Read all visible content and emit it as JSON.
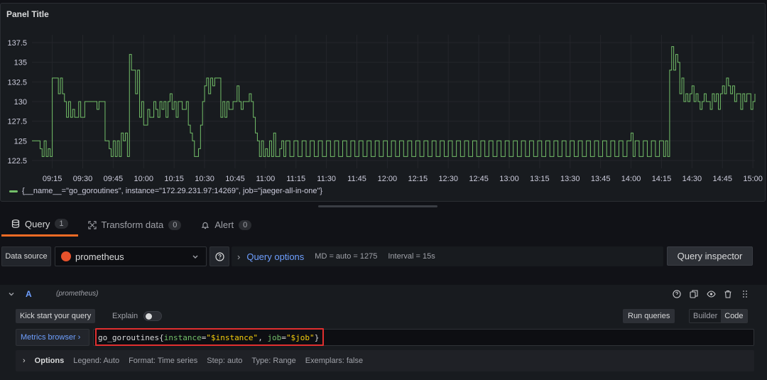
{
  "panel": {
    "title": "Panel Title",
    "legend": "{__name__=\"go_goroutines\", instance=\"172.29.231.97:14269\", job=\"jaeger-all-in-one\"}"
  },
  "chart_data": {
    "type": "line",
    "title": "Panel Title",
    "ylim": [
      121.5,
      138.5
    ],
    "yticks": [
      "122.5",
      "125",
      "127.5",
      "130",
      "132.5",
      "135",
      "137.5"
    ],
    "xticks": [
      "09:15",
      "09:30",
      "09:45",
      "10:00",
      "10:15",
      "10:30",
      "10:45",
      "11:00",
      "11:15",
      "11:30",
      "11:45",
      "12:00",
      "12:15",
      "12:30",
      "12:45",
      "13:00",
      "13:15",
      "13:30",
      "13:45",
      "14:00",
      "14:15",
      "14:30",
      "14:45",
      "15:00"
    ],
    "grid": true,
    "legend_position": "bottom",
    "series": [
      {
        "name": "{__name__=\"go_goroutines\", instance=\"172.29.231.97:14269\", job=\"jaeger-all-in-one\"}",
        "color": "#73bf69",
        "points": [
          [
            "09:05",
            125
          ],
          [
            "09:08",
            125
          ],
          [
            "09:09",
            124
          ],
          [
            "09:10",
            123
          ],
          [
            "09:11",
            125
          ],
          [
            "09:12",
            123
          ],
          [
            "09:13",
            124
          ],
          [
            "09:14",
            123
          ],
          [
            "09:15",
            133
          ],
          [
            "09:17",
            133
          ],
          [
            "09:18",
            131
          ],
          [
            "09:19",
            133
          ],
          [
            "09:20",
            131
          ],
          [
            "09:21",
            130
          ],
          [
            "09:22",
            128
          ],
          [
            "09:23",
            130
          ],
          [
            "09:24",
            128
          ],
          [
            "09:25",
            129
          ],
          [
            "09:26",
            128
          ],
          [
            "09:28",
            130
          ],
          [
            "09:29",
            128
          ],
          [
            "09:30",
            128
          ],
          [
            "09:31",
            130
          ],
          [
            "09:36",
            130
          ],
          [
            "09:37",
            129
          ],
          [
            "09:38",
            130
          ],
          [
            "09:40",
            130
          ],
          [
            "09:41",
            125
          ],
          [
            "09:43",
            124
          ],
          [
            "09:44",
            123
          ],
          [
            "09:45",
            125
          ],
          [
            "09:46",
            123
          ],
          [
            "09:47",
            125
          ],
          [
            "09:48",
            123
          ],
          [
            "09:49",
            126
          ],
          [
            "09:50",
            125
          ],
          [
            "09:51",
            126
          ],
          [
            "09:52",
            123
          ],
          [
            "09:53",
            136
          ],
          [
            "09:54",
            134
          ],
          [
            "09:55",
            134
          ],
          [
            "09:56",
            131
          ],
          [
            "09:57",
            134
          ],
          [
            "09:58",
            128
          ],
          [
            "09:59",
            130
          ],
          [
            "10:00",
            127
          ],
          [
            "10:02",
            129
          ],
          [
            "10:03",
            128
          ],
          [
            "10:05",
            130
          ],
          [
            "10:06",
            129
          ],
          [
            "10:07",
            128
          ],
          [
            "10:08",
            130
          ],
          [
            "10:09",
            129
          ],
          [
            "10:10",
            130
          ],
          [
            "10:11",
            128
          ],
          [
            "10:12",
            130
          ],
          [
            "10:13",
            131
          ],
          [
            "10:14",
            129
          ],
          [
            "10:15",
            130
          ],
          [
            "10:16",
            128
          ],
          [
            "10:17",
            130
          ],
          [
            "10:18",
            130
          ],
          [
            "10:19",
            129
          ],
          [
            "10:20",
            129
          ],
          [
            "10:21",
            130
          ],
          [
            "10:22",
            127
          ],
          [
            "10:23",
            126
          ],
          [
            "10:24",
            125
          ],
          [
            "10:25",
            123
          ],
          [
            "10:26",
            123
          ],
          [
            "10:27",
            124
          ],
          [
            "10:28",
            127
          ],
          [
            "10:29",
            130
          ],
          [
            "10:30",
            132
          ],
          [
            "10:31",
            133
          ],
          [
            "10:32",
            131
          ],
          [
            "10:33",
            133
          ],
          [
            "10:34",
            132
          ],
          [
            "10:35",
            133
          ],
          [
            "10:37",
            133
          ],
          [
            "10:38",
            128
          ],
          [
            "10:39",
            130
          ],
          [
            "10:40",
            128
          ],
          [
            "10:41",
            130
          ],
          [
            "10:42",
            129
          ],
          [
            "10:43",
            129
          ],
          [
            "10:44",
            130
          ],
          [
            "10:45",
            130
          ],
          [
            "10:46",
            132
          ],
          [
            "10:47",
            130
          ],
          [
            "10:48",
            129
          ],
          [
            "10:49",
            130
          ],
          [
            "10:51",
            130
          ],
          [
            "10:52",
            131
          ],
          [
            "10:53",
            130
          ],
          [
            "10:54",
            128
          ],
          [
            "10:55",
            126
          ],
          [
            "10:56",
            125
          ],
          [
            "10:57",
            123
          ],
          [
            "10:58",
            125
          ],
          [
            "10:59",
            123
          ],
          [
            "11:00",
            124
          ],
          [
            "11:01",
            123
          ],
          [
            "11:02",
            125
          ],
          [
            "11:03",
            123
          ],
          [
            "11:04",
            126
          ],
          [
            "11:05",
            123
          ],
          [
            "11:07",
            124
          ],
          [
            "11:08",
            125
          ],
          [
            "11:09",
            123
          ],
          [
            "11:10",
            125
          ],
          [
            "11:12",
            123
          ],
          [
            "11:14",
            125
          ],
          [
            "11:16",
            123
          ],
          [
            "11:18",
            125
          ],
          [
            "11:20",
            123
          ],
          [
            "11:22",
            125
          ],
          [
            "11:24",
            123
          ],
          [
            "11:26",
            125
          ],
          [
            "11:28",
            123
          ],
          [
            "11:30",
            125
          ],
          [
            "11:32",
            123
          ],
          [
            "11:34",
            125
          ],
          [
            "11:36",
            123
          ],
          [
            "11:38",
            125
          ],
          [
            "11:40",
            123
          ],
          [
            "11:42",
            125
          ],
          [
            "11:44",
            123
          ],
          [
            "11:46",
            125
          ],
          [
            "11:48",
            123
          ],
          [
            "11:50",
            125
          ],
          [
            "11:52",
            123
          ],
          [
            "11:54",
            125
          ],
          [
            "11:56",
            123
          ],
          [
            "11:58",
            125
          ],
          [
            "12:00",
            123
          ],
          [
            "12:02",
            125
          ],
          [
            "12:04",
            123
          ],
          [
            "12:06",
            125
          ],
          [
            "12:08",
            123
          ],
          [
            "12:10",
            125
          ],
          [
            "12:12",
            123
          ],
          [
            "12:14",
            125
          ],
          [
            "12:16",
            123
          ],
          [
            "12:18",
            125
          ],
          [
            "12:20",
            123
          ],
          [
            "12:22",
            125
          ],
          [
            "12:24",
            123
          ],
          [
            "12:26",
            125
          ],
          [
            "12:28",
            123
          ],
          [
            "12:30",
            125
          ],
          [
            "12:32",
            123
          ],
          [
            "12:34",
            125
          ],
          [
            "12:36",
            123
          ],
          [
            "12:38",
            125
          ],
          [
            "12:40",
            123
          ],
          [
            "12:42",
            125
          ],
          [
            "12:44",
            123
          ],
          [
            "12:46",
            125
          ],
          [
            "12:48",
            123
          ],
          [
            "12:50",
            125
          ],
          [
            "12:52",
            123
          ],
          [
            "12:54",
            125
          ],
          [
            "12:56",
            123
          ],
          [
            "12:58",
            125
          ],
          [
            "13:00",
            123
          ],
          [
            "13:02",
            125
          ],
          [
            "13:04",
            123
          ],
          [
            "13:06",
            125
          ],
          [
            "13:08",
            123
          ],
          [
            "13:10",
            125
          ],
          [
            "13:12",
            123
          ],
          [
            "13:14",
            125
          ],
          [
            "13:16",
            123
          ],
          [
            "13:18",
            125
          ],
          [
            "13:20",
            123
          ],
          [
            "13:22",
            125
          ],
          [
            "13:24",
            123
          ],
          [
            "13:26",
            125
          ],
          [
            "13:28",
            123
          ],
          [
            "13:30",
            125
          ],
          [
            "13:32",
            123
          ],
          [
            "13:34",
            125
          ],
          [
            "13:36",
            123
          ],
          [
            "13:38",
            125
          ],
          [
            "13:40",
            123
          ],
          [
            "13:42",
            125
          ],
          [
            "13:44",
            123
          ],
          [
            "13:46",
            125
          ],
          [
            "13:48",
            123
          ],
          [
            "13:50",
            125
          ],
          [
            "13:52",
            123
          ],
          [
            "13:54",
            125
          ],
          [
            "13:56",
            123
          ],
          [
            "13:58",
            125
          ],
          [
            "14:00",
            126
          ],
          [
            "14:01",
            123
          ],
          [
            "14:02",
            125
          ],
          [
            "14:04",
            123
          ],
          [
            "14:06",
            125
          ],
          [
            "14:08",
            123
          ],
          [
            "14:10",
            125
          ],
          [
            "14:12",
            123
          ],
          [
            "14:14",
            125
          ],
          [
            "14:16",
            123
          ],
          [
            "14:17",
            125
          ],
          [
            "14:18",
            123
          ],
          [
            "14:19",
            134
          ],
          [
            "14:20",
            137
          ],
          [
            "14:21",
            134
          ],
          [
            "14:22",
            136
          ],
          [
            "14:23",
            135
          ],
          [
            "14:24",
            131
          ],
          [
            "14:25",
            133
          ],
          [
            "14:26",
            130
          ],
          [
            "14:27",
            131
          ],
          [
            "14:28",
            130
          ],
          [
            "14:29",
            131
          ],
          [
            "14:30",
            132
          ],
          [
            "14:31",
            130
          ],
          [
            "14:32",
            131
          ],
          [
            "14:33",
            130
          ],
          [
            "14:34",
            129
          ],
          [
            "14:35",
            130
          ],
          [
            "14:36",
            131
          ],
          [
            "14:37",
            130
          ],
          [
            "14:38",
            130
          ],
          [
            "14:39",
            129
          ],
          [
            "14:40",
            131
          ],
          [
            "14:41",
            130
          ],
          [
            "14:42",
            131
          ],
          [
            "14:43",
            129
          ],
          [
            "14:44",
            131
          ],
          [
            "14:45",
            132
          ],
          [
            "14:46",
            131
          ],
          [
            "14:47",
            133
          ],
          [
            "14:48",
            132
          ],
          [
            "14:49",
            131
          ],
          [
            "14:50",
            132
          ],
          [
            "14:51",
            130
          ],
          [
            "14:52",
            131
          ],
          [
            "14:53",
            131
          ],
          [
            "14:54",
            129
          ],
          [
            "14:55",
            131
          ],
          [
            "14:56",
            130
          ],
          [
            "14:57",
            131
          ],
          [
            "14:58",
            131
          ],
          [
            "14:59",
            129
          ],
          [
            "15:00",
            130
          ],
          [
            "15:01",
            131
          ]
        ]
      }
    ]
  },
  "tabs": [
    {
      "label": "Query",
      "count": "1",
      "icon": "database-icon"
    },
    {
      "label": "Transform data",
      "count": "0",
      "icon": "transform-icon"
    },
    {
      "label": "Alert",
      "count": "0",
      "icon": "bell-icon"
    }
  ],
  "datasource": {
    "label": "Data source",
    "selected": "prometheus",
    "query_options_label": "Query options",
    "md": "MD = auto = 1275",
    "interval": "Interval = 15s",
    "inspector_label": "Query inspector"
  },
  "query": {
    "ref": "A",
    "datasource_hint": "(prometheus)",
    "kick_start_label": "Kick start your query",
    "explain_label": "Explain",
    "run_label": "Run queries",
    "modes": [
      "Builder",
      "Code"
    ],
    "active_mode": "Code",
    "metrics_browser_label": "Metrics browser ›",
    "expr": {
      "metric": "go_goroutines",
      "open": "{",
      "label1": "instance",
      "eq1": "=",
      "value1": "\"$instance\"",
      "sep": ", ",
      "label2": "job",
      "eq2": "=",
      "value2": "\"$job\"",
      "close": "}"
    },
    "options": {
      "title": "Options",
      "legend": "Legend: Auto",
      "format": "Format: Time series",
      "step": "Step: auto",
      "type": "Type: Range",
      "exemplars": "Exemplars: false"
    }
  },
  "colors": {
    "series": "#73bf69",
    "accent": "#f36b25",
    "link": "#6e9fff",
    "highlight": "#e02f2f"
  }
}
